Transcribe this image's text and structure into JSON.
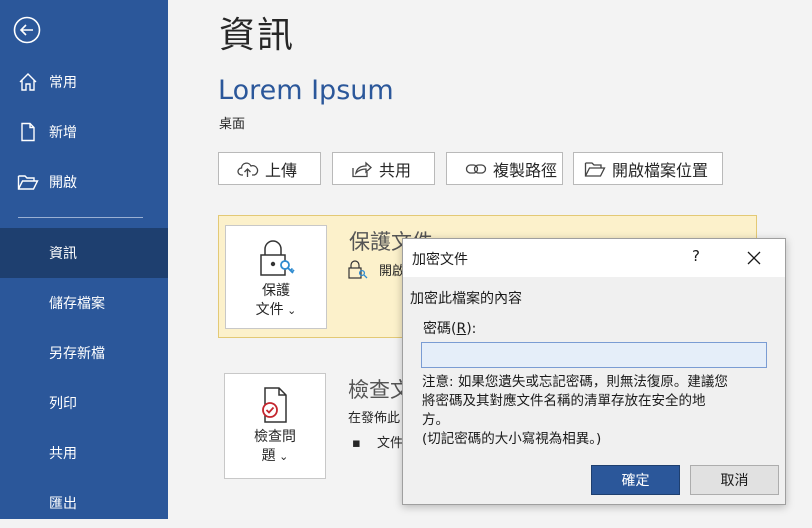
{
  "sidebar": {
    "items": [
      {
        "label": "常用",
        "icon": "home-icon"
      },
      {
        "label": "新增",
        "icon": "new-document-icon"
      },
      {
        "label": "開啟",
        "icon": "open-folder-icon"
      },
      {
        "label": "資訊"
      },
      {
        "label": "儲存檔案"
      },
      {
        "label": "另存新檔"
      },
      {
        "label": "列印"
      },
      {
        "label": "共用"
      },
      {
        "label": "匯出"
      }
    ],
    "active_index": 3
  },
  "main": {
    "page_title": "資訊",
    "document_name": "Lorem Ipsum",
    "document_location": "桌面",
    "actions": {
      "upload": "上傳",
      "share": "共用",
      "copy_path": "複製路徑",
      "open_location": "開啟檔案位置"
    },
    "protect": {
      "button_line1": "保護",
      "button_line2": "文件",
      "title": "保護文件",
      "desc": "開啟"
    },
    "inspect": {
      "button_line1": "檢查問",
      "button_line2": "題",
      "title": "檢查文",
      "desc": "在發佈此",
      "bullet": "文件"
    }
  },
  "dialog": {
    "title": "加密文件",
    "help": "?",
    "group_label": "加密此檔案的內容",
    "password_label_prefix": "密碼(",
    "password_label_key": "R",
    "password_label_suffix": "):",
    "password_value": "",
    "note_line1": "注意: 如果您遺失或忘記密碼，則無法復原。建議您",
    "note_line2": "將密碼及其對應文件名稱的清單存放在安全的地",
    "note_line3": "方。",
    "note_line4": "(切記密碼的大小寫視為相異。)",
    "ok_label": "確定",
    "cancel_label": "取消"
  },
  "colors": {
    "accent": "#2b579a",
    "active_nav": "#1e3f6f",
    "protect_bg": "#fcf1cb"
  }
}
